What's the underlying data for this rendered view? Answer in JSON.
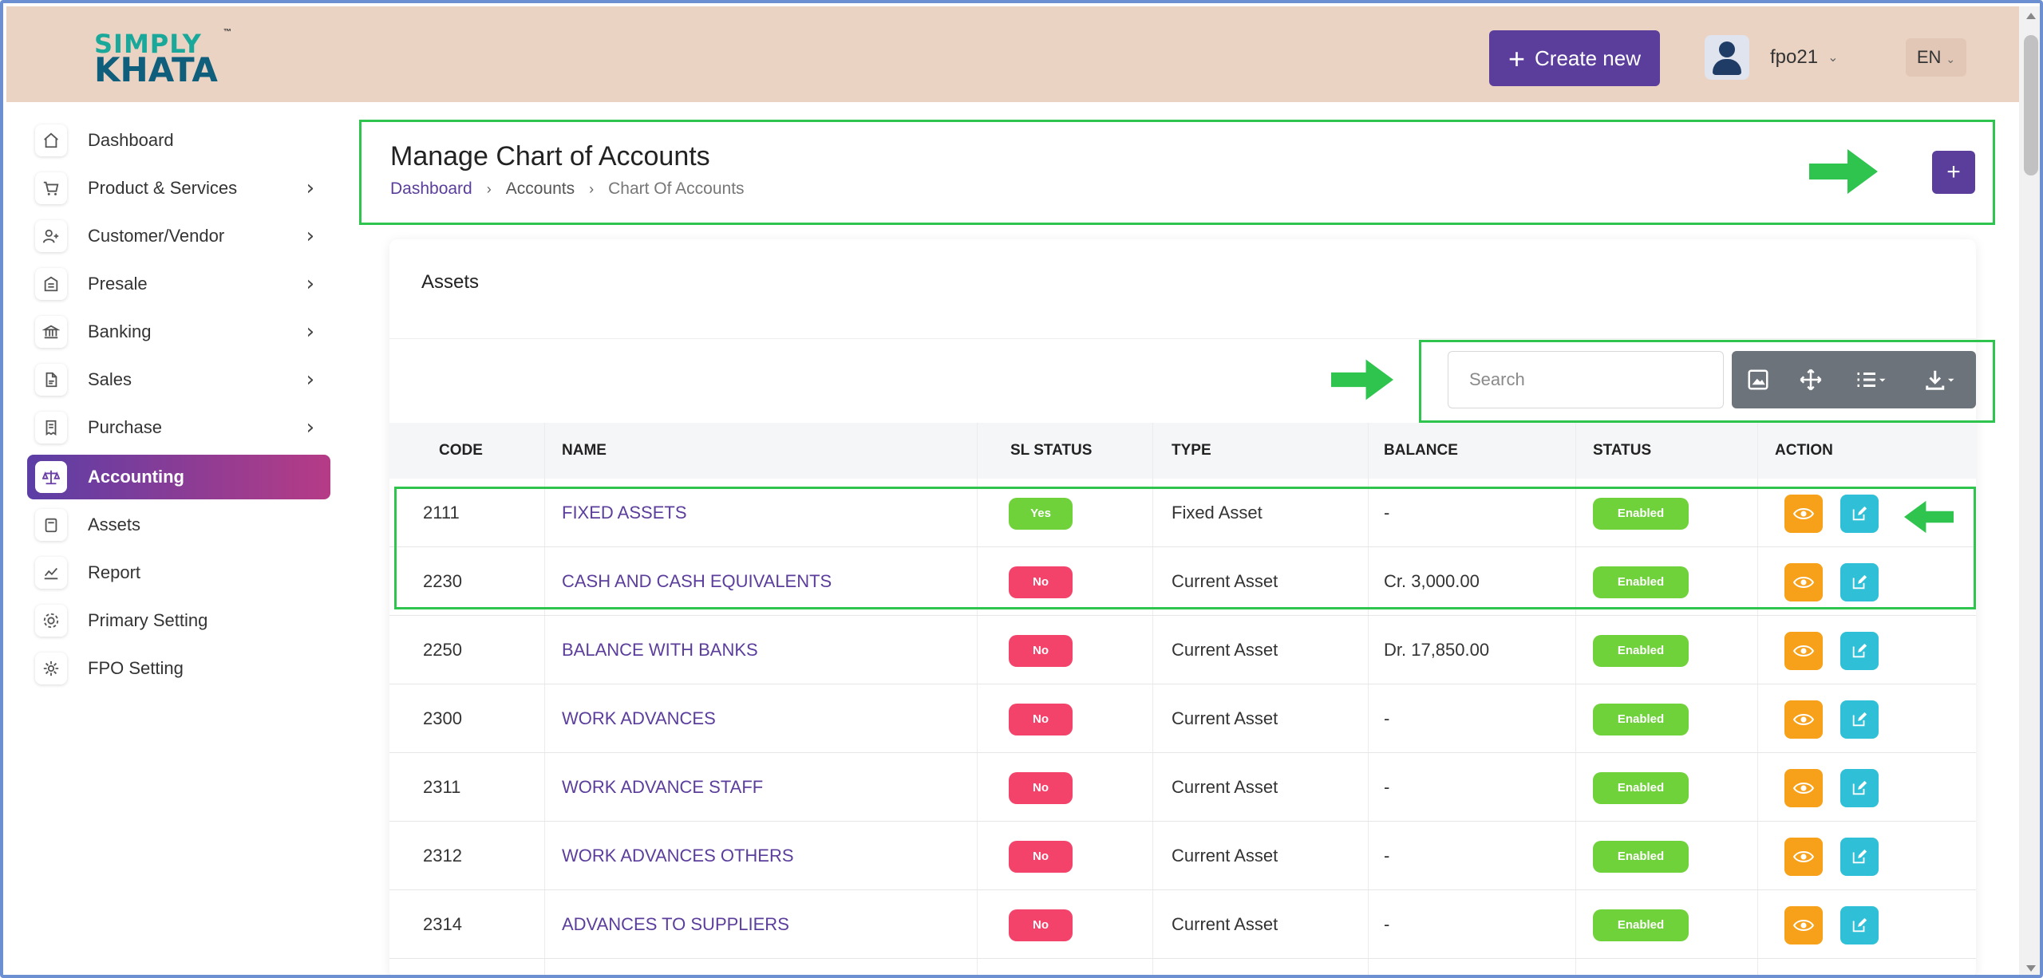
{
  "header": {
    "logo_line1": "SIMPLY",
    "logo_line2": "KHATA",
    "logo_tm": "™",
    "create_new_label": "Create new",
    "username": "fpo21",
    "language": "EN"
  },
  "sidebar": {
    "items": [
      {
        "label": "Dashboard",
        "icon": "home-icon",
        "has_arrow": false
      },
      {
        "label": "Product & Services",
        "icon": "cart-icon",
        "has_arrow": true
      },
      {
        "label": "Customer/Vendor",
        "icon": "user-add-icon",
        "has_arrow": true
      },
      {
        "label": "Presale",
        "icon": "building-icon",
        "has_arrow": true
      },
      {
        "label": "Banking",
        "icon": "bank-icon",
        "has_arrow": true
      },
      {
        "label": "Sales",
        "icon": "file-icon",
        "has_arrow": true
      },
      {
        "label": "Purchase",
        "icon": "receipt-icon",
        "has_arrow": true
      },
      {
        "label": "Accounting",
        "icon": "scale-icon",
        "has_arrow": false,
        "active": true
      },
      {
        "label": "Assets",
        "icon": "box-icon",
        "has_arrow": false
      },
      {
        "label": "Report",
        "icon": "chart-icon",
        "has_arrow": false
      },
      {
        "label": "Primary Setting",
        "icon": "cog-settings-icon",
        "has_arrow": false
      },
      {
        "label": "FPO Setting",
        "icon": "gear-icon",
        "has_arrow": false
      }
    ]
  },
  "page": {
    "title": "Manage Chart of Accounts",
    "breadcrumb": [
      "Dashboard",
      "Accounts",
      "Chart Of Accounts"
    ],
    "add_label": "+"
  },
  "card": {
    "title": "Assets",
    "search_placeholder": "Search"
  },
  "table": {
    "columns": [
      "CODE",
      "NAME",
      "SL STATUS",
      "TYPE",
      "BALANCE",
      "STATUS",
      "ACTION"
    ],
    "rows": [
      {
        "code": "2111",
        "name": "FIXED ASSETS",
        "sl_status": "Yes",
        "type": "Fixed Asset",
        "balance": "-",
        "status": "Enabled"
      },
      {
        "code": "2230",
        "name": "CASH AND CASH EQUIVALENTS",
        "sl_status": "No",
        "type": "Current Asset",
        "balance": "Cr. 3,000.00",
        "status": "Enabled"
      },
      {
        "code": "2250",
        "name": "BALANCE WITH BANKS",
        "sl_status": "No",
        "type": "Current Asset",
        "balance": "Dr. 17,850.00",
        "status": "Enabled"
      },
      {
        "code": "2300",
        "name": "WORK ADVANCES",
        "sl_status": "No",
        "type": "Current Asset",
        "balance": "-",
        "status": "Enabled"
      },
      {
        "code": "2311",
        "name": "WORK ADVANCE STAFF",
        "sl_status": "No",
        "type": "Current Asset",
        "balance": "-",
        "status": "Enabled"
      },
      {
        "code": "2312",
        "name": "WORK ADVANCES OTHERS",
        "sl_status": "No",
        "type": "Current Asset",
        "balance": "-",
        "status": "Enabled"
      },
      {
        "code": "2314",
        "name": "ADVANCES TO SUPPLIERS",
        "sl_status": "No",
        "type": "Current Asset",
        "balance": "-",
        "status": "Enabled"
      }
    ]
  },
  "colors": {
    "brand_purple": "#5b3e9c",
    "header_bg": "#ead3c3",
    "yes_green": "#6fd23b",
    "no_red": "#f4436b",
    "view_orange": "#f7a11a",
    "edit_cyan": "#2fc0d8",
    "highlight_green": "#2ec44e"
  }
}
